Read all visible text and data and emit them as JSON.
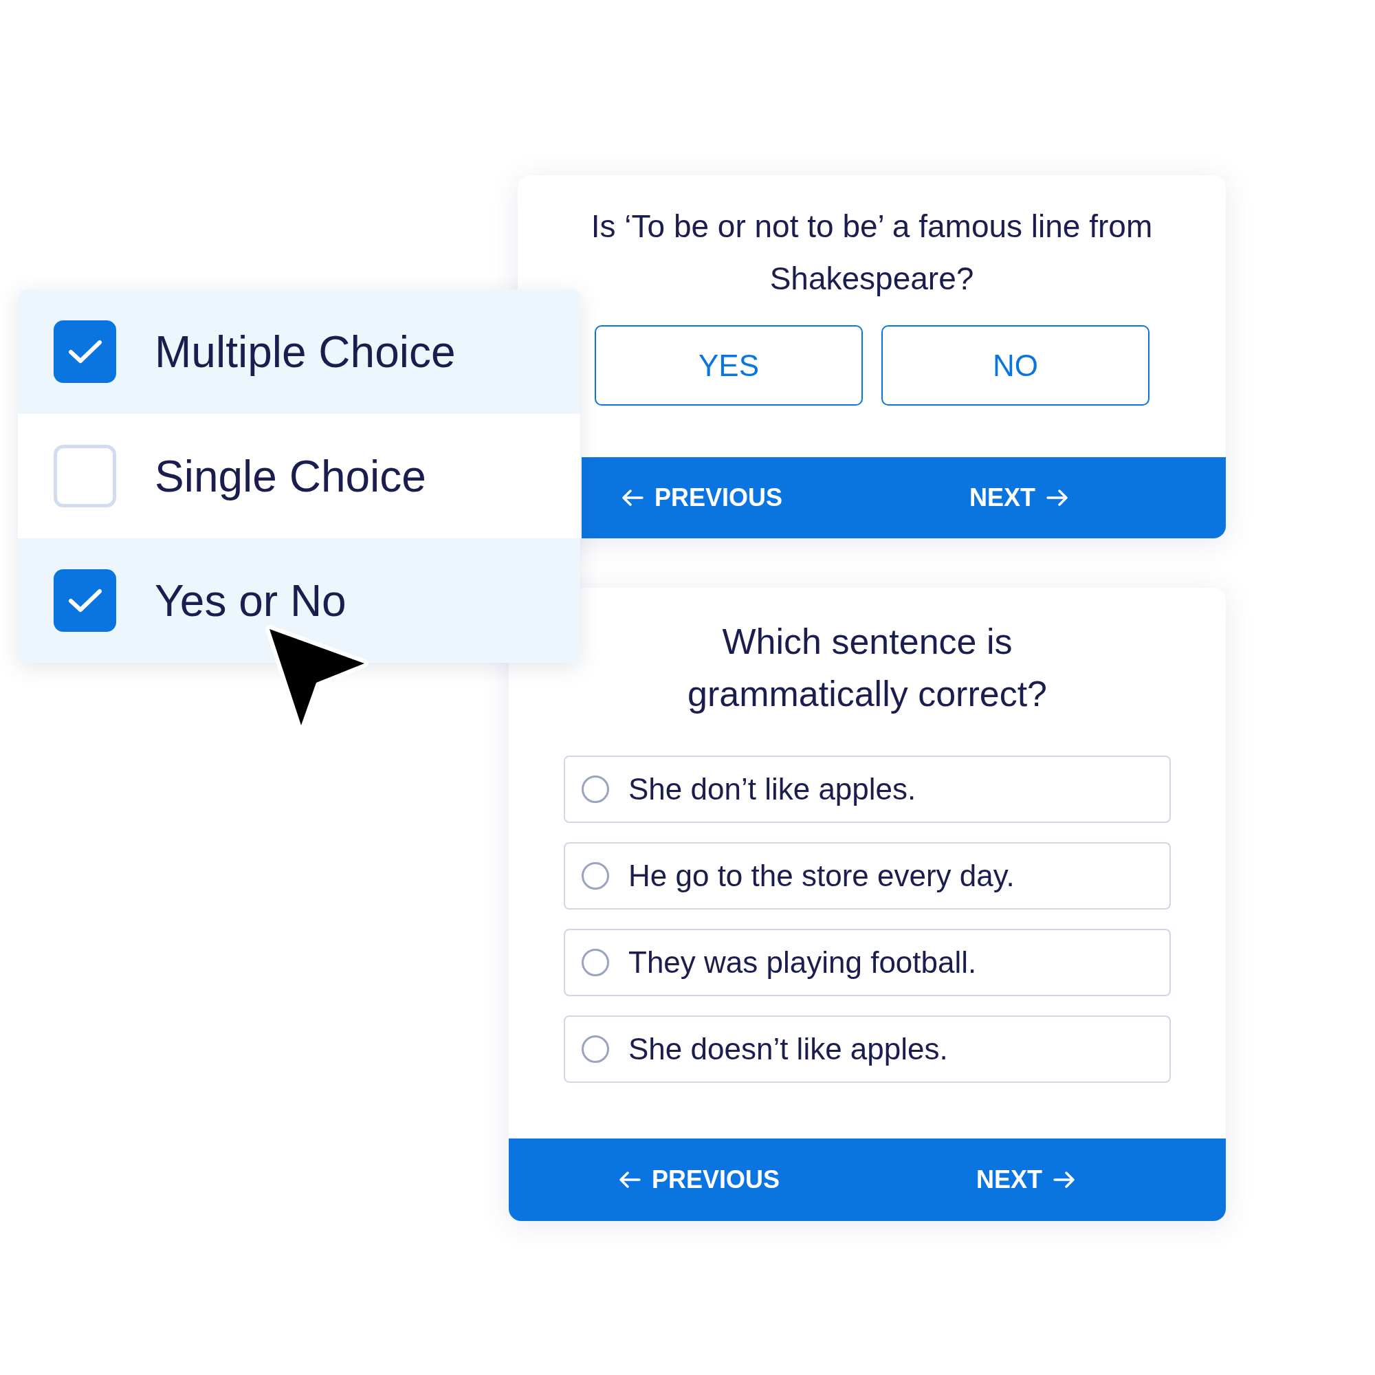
{
  "question_types": [
    {
      "label": "Multiple Choice",
      "checked": true
    },
    {
      "label": "Single Choice",
      "checked": false
    },
    {
      "label": "Yes or No",
      "checked": true
    }
  ],
  "yes_no_card": {
    "question": "Is ‘To be or not to be’ a famous line from Shakespeare?",
    "answers": [
      "YES",
      "NO"
    ],
    "nav": {
      "previous": "PREVIOUS",
      "next": "NEXT"
    }
  },
  "grammar_card": {
    "question": "Which sentence is grammatically correct?",
    "options": [
      {
        "label": "She don’t like apples.",
        "selected": false
      },
      {
        "label": "He go to the store every day.",
        "selected": false
      },
      {
        "label": "They was playing football.",
        "selected": false
      },
      {
        "label": "She doesn’t like apples.",
        "selected": false
      }
    ],
    "nav": {
      "previous": "PREVIOUS",
      "next": "NEXT"
    }
  }
}
